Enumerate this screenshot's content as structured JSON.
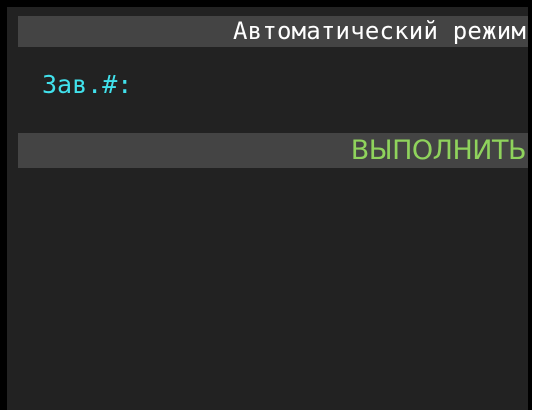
{
  "header": {
    "title": "Автоматический режим"
  },
  "form": {
    "serial_label": "Зав.#:"
  },
  "action": {
    "execute_label": "ВЫПОЛНИТЬ"
  },
  "colors": {
    "background": "#222222",
    "bar": "#444444",
    "title_text": "#ffffff",
    "label_text": "#41e1ec",
    "action_text": "#8fd35c"
  }
}
